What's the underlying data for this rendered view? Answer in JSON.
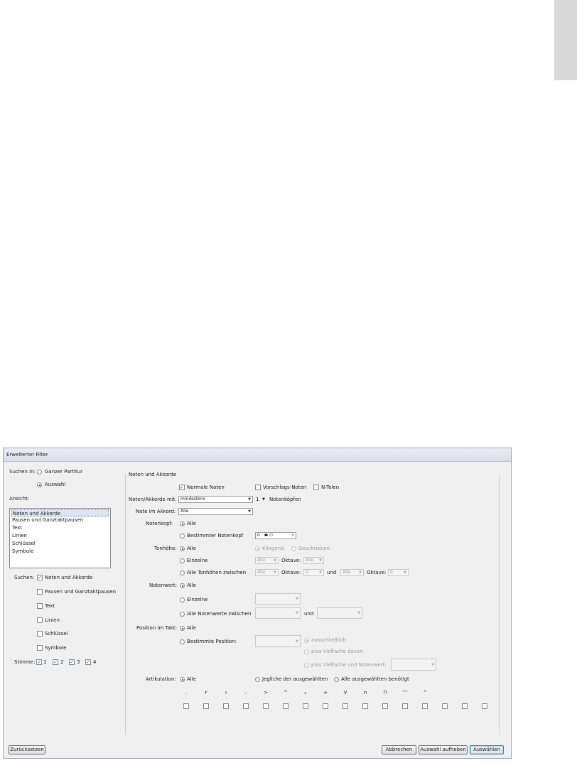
{
  "window": {
    "title": "Erweiterter Filter"
  },
  "left": {
    "search_in_label": "Suchen in:",
    "search_in_options": [
      "Ganzer Partitur",
      "Auswahl"
    ],
    "view_label": "Ansicht:",
    "view_items": [
      "Noten und Akkorde",
      "Pausen und Ganztaktpausen",
      "Text",
      "Linien",
      "Schlüssel",
      "Symbole"
    ],
    "search_label": "Suchen:",
    "search_items": [
      "Noten und Akkorde",
      "Pausen und Ganztaktpausen",
      "Text",
      "Linien",
      "Schlüssel",
      "Symbole"
    ],
    "voices_label": "Stimme:",
    "voices": [
      "1",
      "2",
      "3",
      "4"
    ]
  },
  "panel": {
    "title": "Noten und Akkorde",
    "normal_notes": "Normale Noten",
    "grace_notes": "Vorschlags-Noten",
    "tuplets": "N-Tolen",
    "notes_with_label": "Noten/Akkorde mit",
    "notes_with_value": "mindestens",
    "count_value": "1",
    "noteheads_label": "Notenköpfen",
    "note_in_chord_label": "Note im Akkord:",
    "note_in_chord_value": "Alle",
    "notehead_label": "Notenkopf:",
    "all": "Alle",
    "specific_notehead": "Bestimmter Notenkopf",
    "notehead_value": "0",
    "pitch_label": "Tonhöhe:",
    "sounding": "Klingend",
    "written": "Geschrieben",
    "single": "Einzelne",
    "octave_label": "Oktave:",
    "octave_all": "Alle",
    "pitch_between": "Alle Tonhöhen zwischen",
    "and": "und",
    "zero": "0",
    "duration_label": "Notenwert:",
    "durations_between": "Alle Notenwerte zwischen",
    "position_label": "Position im Takt:",
    "specific_position": "Bestimmte Position:",
    "exclusive": "ausschließlich",
    "plus_multiples": "plus Vielfache davon",
    "plus_multiples_duration": "plus Vielfache und Notenwert:",
    "articulation_label": "Artikulation:",
    "any_selected": "Jegliche der ausgewählten",
    "all_selected": "Alle ausgewählten benötigt",
    "articulation_glyphs": [
      ".",
      "r",
      "ı",
      "–",
      ">",
      "^",
      "ₒ",
      "+",
      "V",
      "п",
      "⊓",
      "⌒",
      "⌃",
      "",
      "",
      ""
    ]
  },
  "buttons": {
    "reset": "Zurücksetzen",
    "cancel": "Abbrechen",
    "deselect": "Auswahl aufheben",
    "select": "Auswählen"
  }
}
